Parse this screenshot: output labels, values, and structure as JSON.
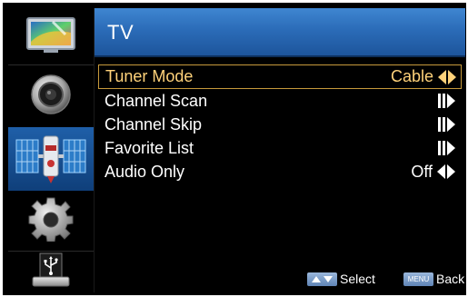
{
  "title": "TV",
  "colors": {
    "title_gradient_top": "#3f86d1",
    "title_gradient_bottom": "#1d559c",
    "selected_text": "#ffd27a",
    "selected_border": "#c79a3c",
    "arrow_selected": "#ffd27a",
    "arrow_normal": "#ffffff",
    "rail_active": "#1f5fa8"
  },
  "rail": [
    {
      "icon": "picture-icon",
      "active": false
    },
    {
      "icon": "audio-speaker-icon",
      "active": false
    },
    {
      "icon": "satellite-tv-icon",
      "active": true
    },
    {
      "icon": "settings-gear-icon",
      "active": false
    },
    {
      "icon": "usb-icon",
      "active": false
    }
  ],
  "menu": [
    {
      "label": "Tuner Mode",
      "value": "Cable",
      "arrow": "left-right",
      "selected": true
    },
    {
      "label": "Channel Scan",
      "value": "",
      "arrow": "enter",
      "selected": false
    },
    {
      "label": "Channel Skip",
      "value": "",
      "arrow": "enter",
      "selected": false
    },
    {
      "label": "Favorite List",
      "value": "",
      "arrow": "enter",
      "selected": false
    },
    {
      "label": "Audio Only",
      "value": "Off",
      "arrow": "left-right",
      "selected": false
    }
  ],
  "footer": {
    "select_label": "Select",
    "menu_key": "MENU",
    "back_label": "Back"
  }
}
